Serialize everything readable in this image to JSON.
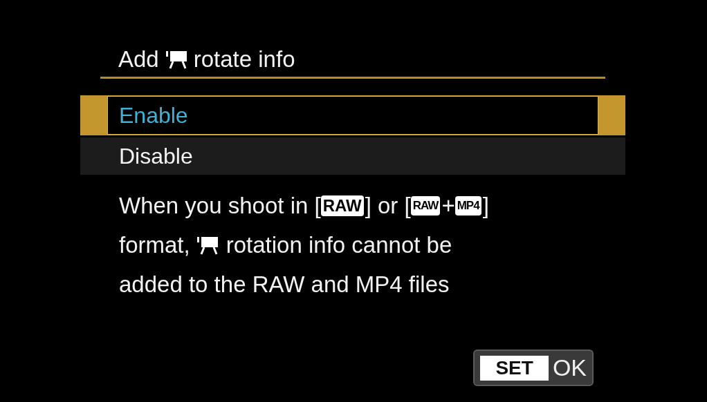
{
  "title": [
    {
      "kind": "text",
      "text": "Add"
    },
    {
      "kind": "movie-icon"
    },
    {
      "kind": "text",
      "text": "rotate info"
    }
  ],
  "options": [
    {
      "label": "Enable",
      "selected": true
    },
    {
      "label": "Disable",
      "selected": false
    }
  ],
  "description": [
    [
      {
        "kind": "text",
        "text": "When you shoot in ["
      },
      {
        "kind": "badge",
        "text": "RAW"
      },
      {
        "kind": "text",
        "text": "] or ["
      },
      {
        "kind": "small-badge",
        "text": "RAW"
      },
      {
        "kind": "text",
        "text": "+"
      },
      {
        "kind": "small-badge",
        "text": "MP4"
      },
      {
        "kind": "text",
        "text": "]"
      }
    ],
    [
      {
        "kind": "text",
        "text": "format,"
      },
      {
        "kind": "movie-icon"
      },
      {
        "kind": "text",
        "text": "rotation info cannot be"
      }
    ],
    [
      {
        "kind": "text",
        "text": "added to the RAW and MP4 files"
      }
    ]
  ],
  "confirm": {
    "key": "SET",
    "label": "OK"
  }
}
